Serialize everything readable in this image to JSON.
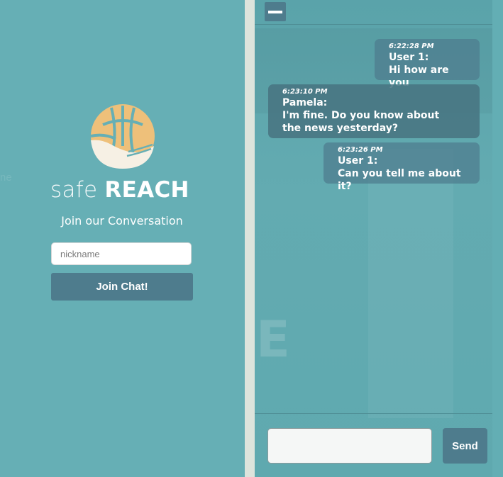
{
  "join_panel": {
    "ghost_text": "ne",
    "brand_light": "safe",
    "brand_bold": "REACH",
    "tagline": "Join our Conversation",
    "nickname_placeholder": "nickname",
    "nickname_value": "",
    "join_button_label": "Join Chat!"
  },
  "chat": {
    "ghost_letter": "E",
    "messages": [
      {
        "time": "6:22:28 PM",
        "sender": "User 1:",
        "text": "Hi how are you",
        "side": "right"
      },
      {
        "time": "6:23:10 PM",
        "sender": "Pamela:",
        "text": "I'm fine. Do you know about the news yesterday?",
        "side": "left"
      },
      {
        "time": "6:23:26 PM",
        "sender": "User 1:",
        "text": "Can you tell me about it?",
        "side": "right"
      }
    ],
    "message_input_value": "",
    "send_button_label": "Send"
  },
  "colors": {
    "background": "#66afb5",
    "accent_button": "#4e7c8d",
    "logo_orange": "#eec07a",
    "logo_cream": "#f6f0e4",
    "divider": "#dde4dc"
  }
}
